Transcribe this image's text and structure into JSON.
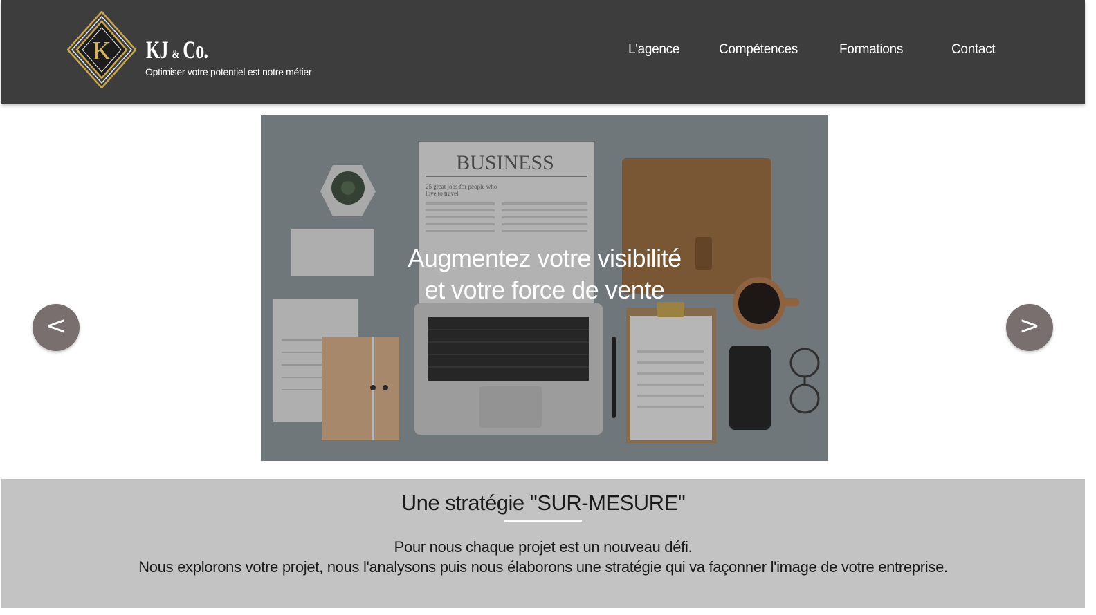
{
  "header": {
    "logo_letter": "K",
    "brand_name": "KJ",
    "brand_amp": "&",
    "brand_suffix": "Co.",
    "tagline": "Optimiser votre potentiel est notre métier",
    "nav": [
      "L'agence",
      "Compétences",
      "Formations",
      "Contact"
    ]
  },
  "hero": {
    "line1": "Augmentez votre visibilité",
    "line2": "et votre force de vente",
    "newspaper_title": "BUSINESS",
    "newspaper_headline_1": "25 great jobs for people who",
    "newspaper_headline_2": "love to travel",
    "prev_label": "<",
    "next_label": ">"
  },
  "strategy": {
    "title": "Une stratégie \"SUR-MESURE\"",
    "p1": "Pour nous chaque projet est un nouveau défi.",
    "p2": "Nous explorons votre projet, nous l'analysons puis nous élaborons une stratégie qui va façonner l'image de votre entreprise."
  },
  "colors": {
    "header_bg": "#3d3d3d",
    "gold": "#c9a64a",
    "arrow_bg": "#7a6f6f",
    "section_bg": "#c3c3c3"
  }
}
